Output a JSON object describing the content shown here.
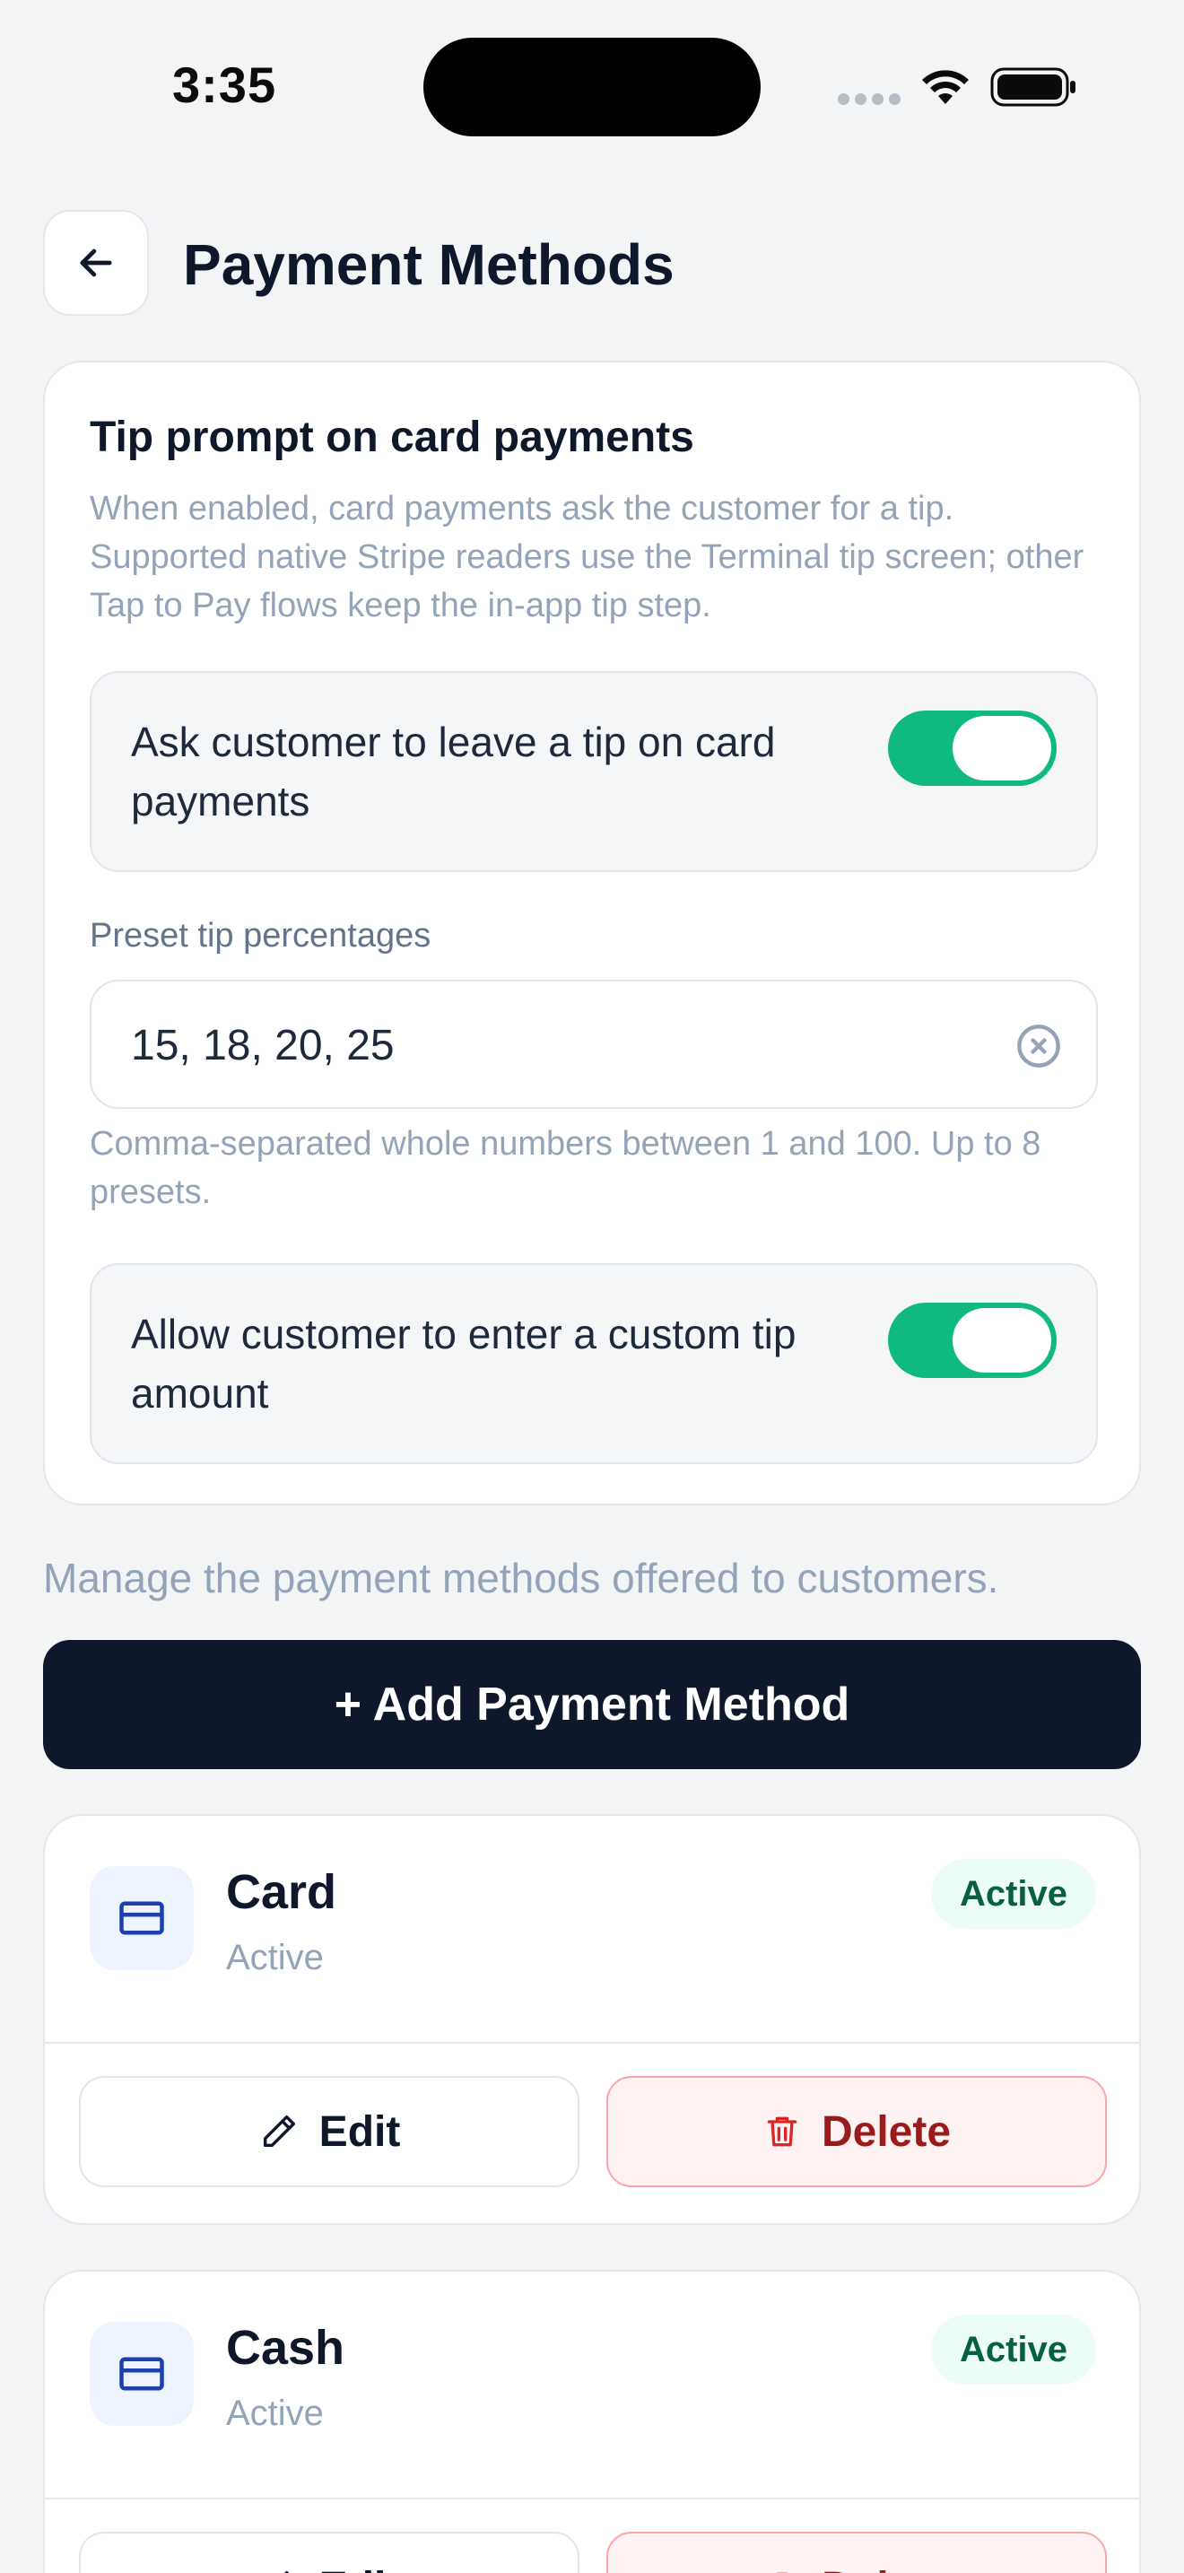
{
  "status_bar": {
    "time": "3:35"
  },
  "header": {
    "title": "Payment Methods"
  },
  "tip_card": {
    "title": "Tip prompt on card payments",
    "description": "When enabled, card payments ask the customer for a tip. Supported native Stripe readers use the Terminal tip screen; other Tap to Pay flows keep the in-app tip step.",
    "ask_tip_toggle": {
      "label": "Ask customer to leave a tip on card payments",
      "on": true
    },
    "preset_label": "Preset tip percentages",
    "preset_value": "15, 18, 20, 25",
    "preset_helper": "Comma-separated whole numbers between 1 and 100. Up to 8 presets.",
    "custom_tip_toggle": {
      "label": "Allow customer to enter a custom tip amount",
      "on": true
    }
  },
  "manage_text": "Manage the payment methods offered to customers.",
  "add_button_label": "+ Add Payment Method",
  "methods": [
    {
      "name": "Card",
      "status": "Active",
      "badge": "Active",
      "edit_label": "Edit",
      "delete_label": "Delete"
    },
    {
      "name": "Cash",
      "status": "Active",
      "badge": "Active",
      "edit_label": "Edit",
      "delete_label": "Delete"
    }
  ],
  "colors": {
    "accent_toggle": "#10b981",
    "primary_button": "#0f172a",
    "badge_bg": "#ecfdf5",
    "badge_text": "#065f46",
    "delete_bg": "#fef2f2",
    "delete_text": "#991b1b",
    "icon_blue": "#1e40af"
  }
}
